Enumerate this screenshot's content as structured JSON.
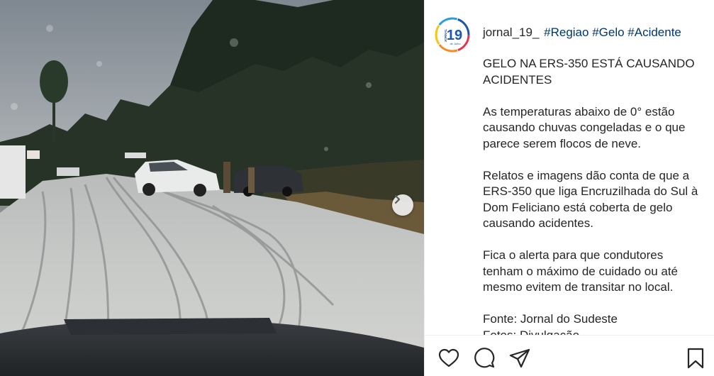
{
  "post": {
    "username": "jornal_19_",
    "hashtags": "#Regiao #Gelo #Acidente",
    "avatar": {
      "number": "19",
      "top_text": "JORNAL",
      "bottom_text": "de Julho",
      "ring_colors": [
        "#e8334a",
        "#f28c28",
        "#f5c518",
        "#2b9fd8",
        "#1d57a5"
      ],
      "number_color": "#1d57a5"
    }
  },
  "caption": {
    "title": "GELO NA ERS-350 ESTÁ CAUSANDO ACIDENTES",
    "paragraph_1": "As temperaturas abaixo de 0° estão causando chuvas congeladas e o que parece serem flocos de neve.",
    "paragraph_2": "Relatos e imagens dão conta de que a ERS-350 que liga Encruzilhada do Sul à Dom Feliciano está coberta de gelo causando acidentes.",
    "paragraph_3": "Fica o alerta para que condutores tenham o máximo de cuidado ou até mesmo evitem de transitar no local.",
    "source_line": "Fonte: Jornal do Sudeste",
    "photo_line": "Fotos: Divulgação"
  },
  "photo": {
    "description_icon": "car-accident-photo",
    "next_icon": "chevron-right-icon"
  },
  "actions": {
    "like_icon": "heart-icon",
    "comment_icon": "comment-icon",
    "share_icon": "share-icon",
    "save_icon": "bookmark-icon"
  }
}
